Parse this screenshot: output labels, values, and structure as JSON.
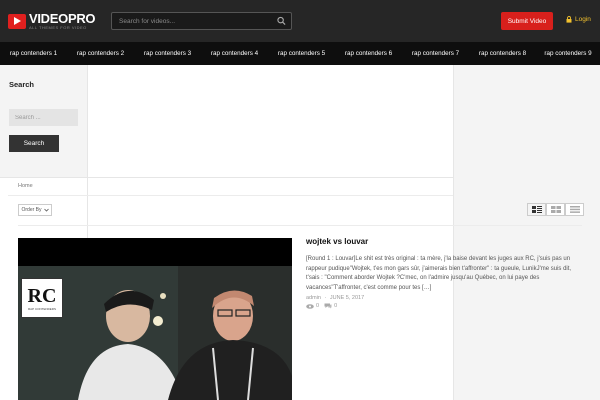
{
  "header": {
    "logo_title": "VIDEOPRO",
    "logo_tagline": "ALL THEMES FOR VIDEO",
    "search_placeholder": "Search for videos...",
    "submit_label": "Submit Video",
    "login_label": "Login"
  },
  "nav": {
    "items": [
      {
        "label": "rap contenders 1"
      },
      {
        "label": "rap contenders 2"
      },
      {
        "label": "rap contenders 3"
      },
      {
        "label": "rap contenders 4"
      },
      {
        "label": "rap contenders 5"
      },
      {
        "label": "rap contenders 6"
      },
      {
        "label": "rap contenders 7"
      },
      {
        "label": "rap contenders 8"
      },
      {
        "label": "rap contenders 9"
      }
    ]
  },
  "sidebar": {
    "title": "Search",
    "input_placeholder": "Search ...",
    "button_label": "Search"
  },
  "breadcrumb": "Home",
  "toolbar": {
    "order_label": "Order By"
  },
  "post": {
    "title": "wojtek vs louvar",
    "excerpt": "[Round 1 : Louvar]Le shit est très original : ta mère, j'la baise devant les juges aux RC, j'suis pas un rappeur pudique\"Wojtek, t'es mon gars sûr, j'aimerais bien t'affronter\" : ta gueule, LunikJ'me suis dit, t'sais : \"Comment aborder Wojtek ?C'mec, on l'admire jusqu'au Québec, on lui paye des vacances\"T'affronter, c'est comme pour tes […]",
    "author": "admin",
    "date": "JUNE 5, 2017",
    "views": "0",
    "comments": "0",
    "thumb_logo": "RC",
    "thumb_logo_sub": "RAP CONTENDERS"
  },
  "colors": {
    "header_bg": "#262626",
    "nav_bg": "#0e0e0e",
    "accent_red": "#d8201c",
    "login_yellow": "#f2c12e"
  }
}
